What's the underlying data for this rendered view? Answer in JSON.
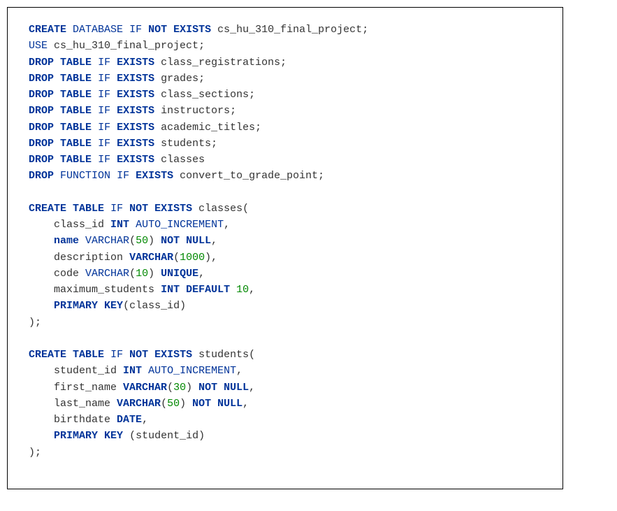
{
  "l1": {
    "a": "CREATE",
    "b": "DATABASE",
    "c": "IF",
    "d": "NOT",
    "e": "EXISTS",
    "f": "cs_hu_310_final_project"
  },
  "l2": {
    "a": "USE",
    "b": "cs_hu_310_final_project"
  },
  "l3": {
    "a": "DROP",
    "b": "TABLE",
    "c": "IF",
    "d": "EXISTS",
    "e": "class_registrations"
  },
  "l4": {
    "a": "DROP",
    "b": "TABLE",
    "c": "IF",
    "d": "EXISTS",
    "e": "grades"
  },
  "l5": {
    "a": "DROP",
    "b": "TABLE",
    "c": "IF",
    "d": "EXISTS",
    "e": "class_sections"
  },
  "l6": {
    "a": "DROP",
    "b": "TABLE",
    "c": "IF",
    "d": "EXISTS",
    "e": "instructors"
  },
  "l7": {
    "a": "DROP",
    "b": "TABLE",
    "c": "IF",
    "d": "EXISTS",
    "e": "academic_titles"
  },
  "l8": {
    "a": "DROP",
    "b": "TABLE",
    "c": "IF",
    "d": "EXISTS",
    "e": "students"
  },
  "l9": {
    "a": "DROP",
    "b": "TABLE",
    "c": "IF",
    "d": "EXISTS",
    "e": "classes"
  },
  "l10": {
    "a": "DROP",
    "b": "FUNCTION",
    "c": "IF",
    "d": "EXISTS",
    "e": "convert_to_grade_point"
  },
  "l11": {
    "a": "CREATE",
    "b": "TABLE",
    "c": "IF",
    "d": "NOT",
    "e": "EXISTS",
    "f": "classes"
  },
  "l12": {
    "a": "class_id",
    "b": "INT",
    "c": "AUTO_INCREMENT"
  },
  "l13": {
    "a": "name",
    "b": "VARCHAR",
    "n": "50",
    "c": "NOT",
    "d": "NULL"
  },
  "l14": {
    "a": "description",
    "b": "VARCHAR",
    "n": "1000"
  },
  "l15": {
    "a": "code",
    "b": "VARCHAR",
    "n": "10",
    "c": "UNIQUE"
  },
  "l16": {
    "a": "maximum_students",
    "b": "INT",
    "c": "DEFAULT",
    "n": "10"
  },
  "l17": {
    "a": "PRIMARY",
    "b": "KEY",
    "c": "class_id"
  },
  "l18": {
    "a": "CREATE",
    "b": "TABLE",
    "c": "IF",
    "d": "NOT",
    "e": "EXISTS",
    "f": "students"
  },
  "l19": {
    "a": "student_id",
    "b": "INT",
    "c": "AUTO_INCREMENT"
  },
  "l20": {
    "a": "first_name",
    "b": "VARCHAR",
    "n": "30",
    "c": "NOT",
    "d": "NULL"
  },
  "l21": {
    "a": "last_name",
    "b": "VARCHAR",
    "n": "50",
    "c": "NOT",
    "d": "NULL"
  },
  "l22": {
    "a": "birthdate",
    "b": "DATE"
  },
  "l23": {
    "a": "PRIMARY",
    "b": "KEY",
    "c": "student_id"
  }
}
